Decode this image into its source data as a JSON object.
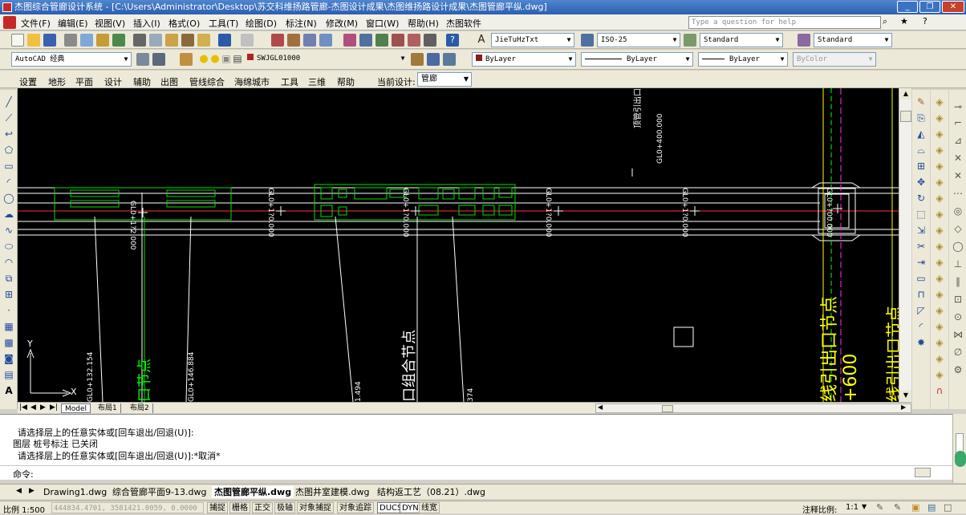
{
  "window": {
    "title": "杰图综合管廊设计系统 - [C:\\Users\\Administrator\\Desktop\\苏交科维扬路管廊-杰图设计成果\\杰图维扬路设计成果\\杰图管廊平纵.dwg]"
  },
  "menu": [
    "文件(F)",
    "编辑(E)",
    "视图(V)",
    "插入(I)",
    "格式(O)",
    "工具(T)",
    "绘图(D)",
    "标注(N)",
    "修改(M)",
    "窗口(W)",
    "帮助(H)",
    "杰图软件"
  ],
  "help_search": {
    "placeholder": "Type a question for help"
  },
  "styles": {
    "text_style": "JieTuHzTxt",
    "dim_style": "ISO-25",
    "table_style": "Standard",
    "multileader_style": "Standard"
  },
  "workspace": {
    "name": "AutoCAD 经典",
    "layer": "SWJGL01000",
    "color": "ByLayer",
    "linetype": "ByLayer",
    "lineweight": "ByLayer",
    "plotstyle": "ByColor"
  },
  "jietu_menu": {
    "items": [
      "设置",
      "地形",
      "平面",
      "设计",
      "辅助",
      "出图",
      "管线综合",
      "海绵城市",
      "工具",
      "三维",
      "帮助"
    ],
    "current_label": "当前设计:",
    "current_value": "管廊"
  },
  "canvas": {
    "stations": [
      "GL0+132.154",
      "GL0+1?2.000",
      "GL0+146.884",
      "GL0+1?0.000",
      "GL0+1?0.000",
      "GL0+1?0.000",
      "GL0+1?0.000",
      "GL0+2?0.000",
      "GL0+?00.000"
    ],
    "vertical_label": "顶管引出口节点",
    "vertical_label2": "GL0+400.000",
    "big_texts": [
      "口组合节点",
      "线引出口节点",
      "+600",
      "线引出口节点",
      "口节点",
      "1.494",
      "374"
    ],
    "axis_y": "Y",
    "axis_x": "X"
  },
  "layout_tabs": [
    "Model",
    "布局1",
    "布局2"
  ],
  "command": {
    "lines": [
      "请选择层上的任意实体或[回车退出/回退(U)]:",
      "图层 桩号标注 已关闭",
      "请选择层上的任意实体或[回车退出/回退(U)]:*取消*"
    ],
    "prompt": "命令:"
  },
  "doc_tabs": [
    "Drawing1.dwg",
    "综合管廊平面9-13.dwg",
    "杰图管廊平纵.dwg",
    "杰图井室建模.dwg",
    "结构返工艺（08.21）.dwg"
  ],
  "doc_tabs_active": 2,
  "status": {
    "scale": "比例 1:500",
    "coords": "444834.4701, 3581421.0059, 0.0000",
    "toggles": [
      "捕捉",
      "栅格",
      "正交",
      "极轴",
      "对象捕捉",
      "对象追踪",
      "DUCS",
      "DYN",
      "线宽"
    ],
    "annot_label": "注释比例:",
    "annot_value": "1:1"
  },
  "colors": {
    "canvas": "#000000",
    "line_white": "#ffffff",
    "line_green": "#00ff00",
    "line_yellow": "#ffff00",
    "line_red": "#ff0000",
    "line_magenta": "#ff00ff"
  }
}
